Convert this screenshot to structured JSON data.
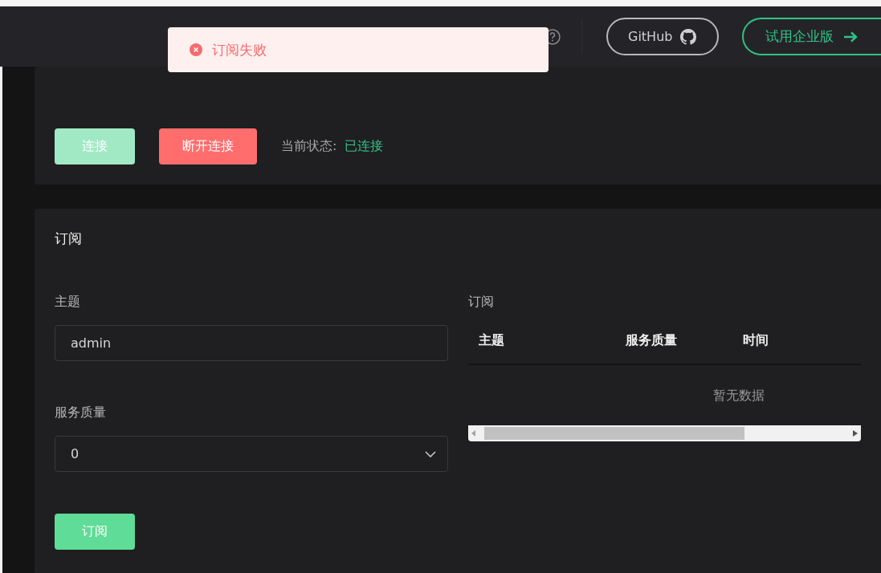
{
  "header": {
    "github_label": "GitHub",
    "enterprise_label": "试用企业版"
  },
  "toast": {
    "message": "订阅失败"
  },
  "connection": {
    "connect_label": "连接",
    "connect_disabled": true,
    "disconnect_label": "断开连接",
    "status_label": "当前状态:",
    "status_value": "已连接"
  },
  "subscribe": {
    "title": "订阅",
    "topic_label": "主题",
    "topic_value": "admin",
    "qos_label": "服务质量",
    "qos_value": "0",
    "submit_label": "订阅",
    "list_title": "订阅",
    "table": {
      "columns": [
        "主题",
        "服务质量",
        "时间"
      ],
      "empty_text": "暂无数据"
    }
  }
}
